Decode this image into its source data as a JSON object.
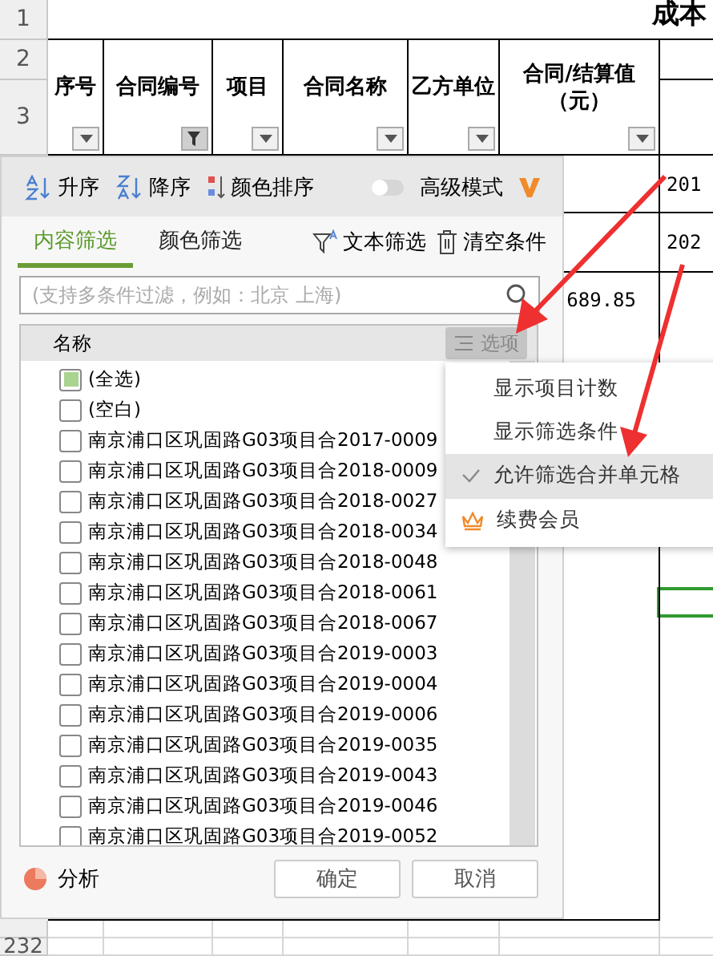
{
  "sheet": {
    "title": "成本",
    "row_numbers": [
      "1",
      "2",
      "3"
    ],
    "columns": [
      {
        "label": "序号",
        "filtered": false
      },
      {
        "label": "合同编号",
        "filtered": true
      },
      {
        "label": "项目",
        "filtered": false
      },
      {
        "label": "合同名称",
        "filtered": false
      },
      {
        "label": "乙方单位",
        "filtered": false
      },
      {
        "label": "合同/结算值（元）",
        "filtered": false
      }
    ],
    "cells": [
      "201",
      "202",
      "689.85"
    ],
    "last_row_number": "232"
  },
  "filter_panel": {
    "sort_buttons": [
      "升序",
      "降序",
      "颜色排序"
    ],
    "advanced_mode": {
      "label": "高级模式",
      "on": false
    },
    "tabs": [
      {
        "label": "内容筛选",
        "selected": true
      },
      {
        "label": "颜色筛选",
        "selected": false
      }
    ],
    "actions": [
      "文本筛选",
      "清空条件"
    ],
    "search": {
      "placeholder": "(支持多条件过滤，例如：北京 上海)"
    },
    "list_header": "名称",
    "options_button": "选项",
    "items": [
      {
        "label": "(全选)",
        "checked": false,
        "indeterminate": true
      },
      {
        "label": "(空白)",
        "checked": false,
        "indeterminate": false
      },
      {
        "label": "南京浦口区巩固路G03项目合2017-0009",
        "checked": false,
        "indeterminate": false
      },
      {
        "label": "南京浦口区巩固路G03项目合2018-0009",
        "checked": false,
        "indeterminate": false
      },
      {
        "label": "南京浦口区巩固路G03项目合2018-0027",
        "checked": false,
        "indeterminate": false
      },
      {
        "label": "南京浦口区巩固路G03项目合2018-0034",
        "checked": false,
        "indeterminate": false
      },
      {
        "label": "南京浦口区巩固路G03项目合2018-0048",
        "checked": false,
        "indeterminate": false
      },
      {
        "label": "南京浦口区巩固路G03项目合2018-0061",
        "checked": false,
        "indeterminate": false
      },
      {
        "label": "南京浦口区巩固路G03项目合2018-0067",
        "checked": false,
        "indeterminate": false
      },
      {
        "label": "南京浦口区巩固路G03项目合2019-0003",
        "checked": false,
        "indeterminate": false
      },
      {
        "label": "南京浦口区巩固路G03项目合2019-0004",
        "checked": false,
        "indeterminate": false
      },
      {
        "label": "南京浦口区巩固路G03项目合2019-0006",
        "checked": false,
        "indeterminate": false
      },
      {
        "label": "南京浦口区巩固路G03项目合2019-0035",
        "checked": false,
        "indeterminate": false
      },
      {
        "label": "南京浦口区巩固路G03项目合2019-0043",
        "checked": false,
        "indeterminate": false
      },
      {
        "label": "南京浦口区巩固路G03项目合2019-0046",
        "checked": false,
        "indeterminate": false
      },
      {
        "label": "南京浦口区巩固路G03项目合2019-0052",
        "checked": false,
        "indeterminate": false
      }
    ],
    "analysis": "分析",
    "buttons": [
      "确定",
      "取消"
    ]
  },
  "options_menu": {
    "items": [
      {
        "label": "显示项目计数",
        "kind": "option",
        "checked": false,
        "hovered": false
      },
      {
        "label": "显示筛选条件",
        "kind": "option",
        "checked": false,
        "hovered": false
      },
      {
        "label": "允许筛选合并单元格",
        "kind": "option",
        "checked": true,
        "hovered": true
      },
      {
        "label": "续费会员",
        "kind": "member",
        "checked": false,
        "hovered": false
      }
    ]
  }
}
